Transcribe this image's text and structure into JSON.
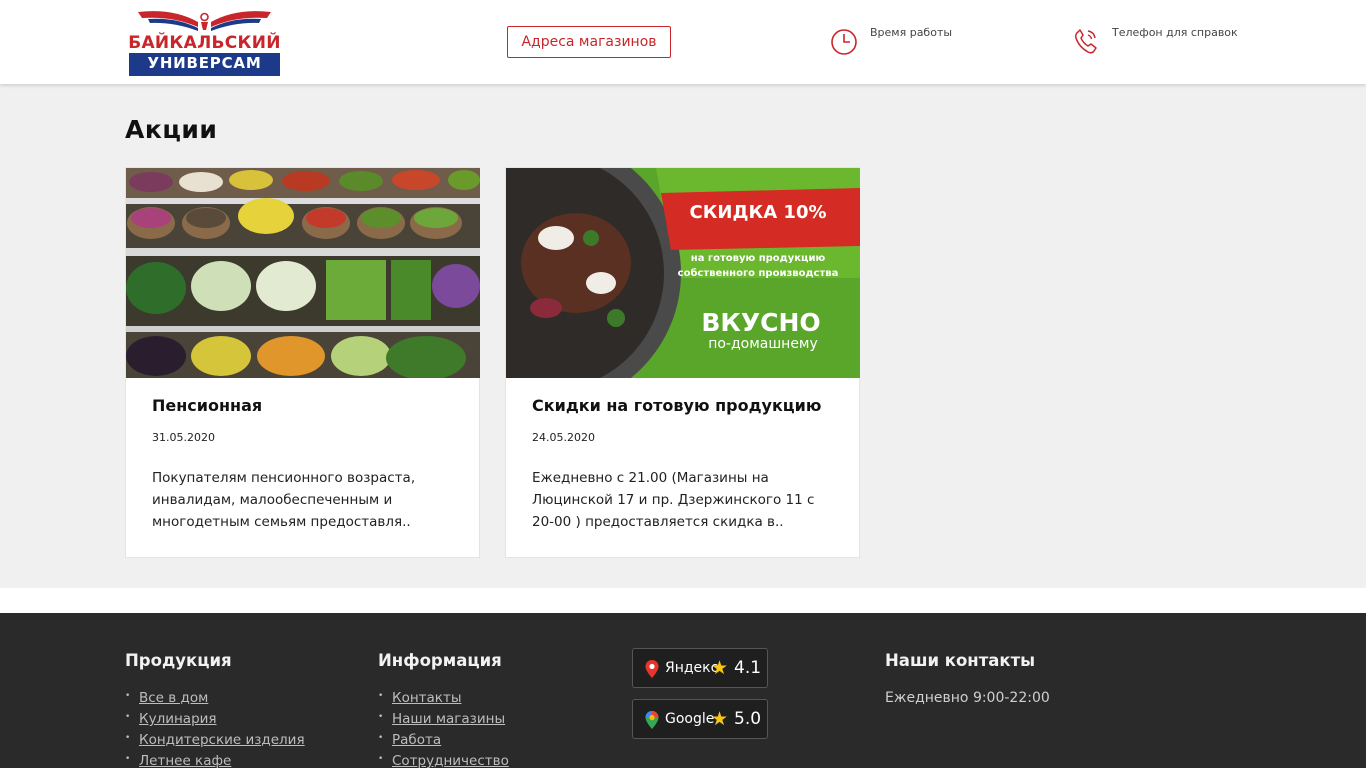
{
  "header": {
    "logo_line1": "БАЙКАЛЬСКИЙ",
    "logo_line2": "УНИВЕРСАМ",
    "addresses_button": "Адреса магазинов",
    "hours_label": "Время работы",
    "phone_label": "Телефон для справок"
  },
  "page": {
    "title": "Акции"
  },
  "cards": [
    {
      "title": "Пенсионная",
      "date": "31.05.2020",
      "text": "Покупателям пенсионного возраста, инвалидам, малообеспеченным и многодетным семьям  предоставля.."
    },
    {
      "title": "Скидки на готовую продукцию",
      "date": "24.05.2020",
      "text": "Ежедневно с 21.00 (Магазины на Люцинской 17 и пр. Дзержинского 11 с 20-00 ) предоставляется скидка в..",
      "banner": {
        "headline": "СКИДКА 10%",
        "sub1": "на готовую продукцию",
        "sub2": "собственного производства",
        "big": "ВКУСНО",
        "small": "по-домашнему"
      }
    }
  ],
  "footer": {
    "products": {
      "title": "Продукция",
      "items": [
        "Все в дом",
        "Кулинария",
        "Кондитерские изделия",
        "Летнее кафе"
      ]
    },
    "info": {
      "title": "Информация",
      "items": [
        "Контакты",
        "Наши магазины",
        "Работа",
        "Сотрудничество"
      ]
    },
    "ratings": [
      {
        "name": "Яндекс",
        "score": "4.1",
        "icon": "yandex-pin-icon"
      },
      {
        "name": "Google",
        "score": "5.0",
        "icon": "google-pin-icon"
      }
    ],
    "contacts": {
      "title": "Наши контакты",
      "hours": "Ежедневно 9:00-22:00"
    }
  },
  "colors": {
    "brand_red": "#c8262b",
    "brand_blue": "#1d3a8a",
    "footer_bg": "#2a2a2a",
    "banner_green": "#5aa62a",
    "star": "#f5c518"
  }
}
